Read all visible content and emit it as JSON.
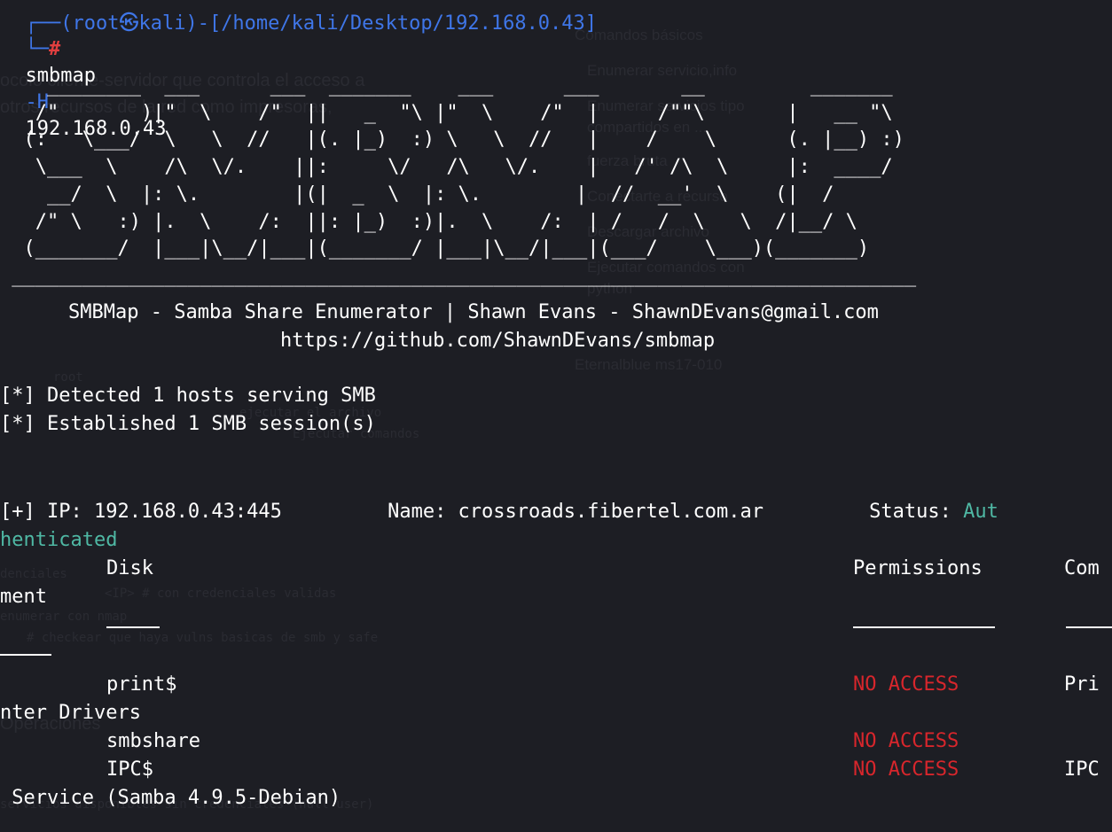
{
  "background_text": {
    "sidebar": [
      "Comandos básicos",
      "Enumerar servicio,info",
      "Enumerar servicios tipo",
      "compartidos en ...",
      "fuerza bruta",
      "Conectarte a recurso",
      "Descargar archivo",
      "Ejecutar comandos con",
      "python",
      "Eternalblue ms17-010"
    ],
    "left_text": [
      "ocolo cliente-servidor que controla el acceso a",
      "otros recursos de la red como impresoras,"
    ],
    "code_lines": [
      "denciales",
      "<IP> # con credenciales validas",
      "enumerar con nmap",
      "# checkear que haya vulns basicas de smb y safe"
    ],
    "bottom_lines": [
      "Operaciones",
      "servicios disponibles sin credenciales (null user)"
    ],
    "upper_code": [
      "root",
      "ejecutar el archivo",
      "Ejecutar comandos"
    ]
  },
  "terminal": {
    "prompt_path": "(root㉿kali)-[/home/kali/Desktop/192.168.0.43]",
    "prompt_hash": "#",
    "command": "smbmap",
    "command_flag": "-H",
    "command_arg": "192.168.0.43",
    "banner_lines": [
      "    ________  ___      ___  _______    ___      ___       __         _______",
      "   /\"       )|\"  \\    /\"  ||   _  \"\\ |\"  \\    /\"  |     /\"\"\\       |   __ \"\\",
      "  (:   \\___/  \\   \\  //   |(. |_)  :) \\   \\  //   |    /    \\      (. |__) :)",
      "   \\___  \\    /\\  \\/.    ||:     \\/   /\\   \\/.    |   /' /\\  \\     |:  ____/",
      "    __/  \\  |: \\.        |(|  _  \\  |: \\.        |  //  __'  \\    (|  /",
      "   /\" \\   :) |.  \\    /:  ||: |_)  :)|.  \\    /:  | /   /  \\   \\  /|__/ \\",
      "  (_______/  |___|\\__/|___|(_______/ |___|\\__/|___|(___/    \\___)(_______)",
      " _____________________________________________________________________________"
    ],
    "credit_line": "SMBMap - Samba Share Enumerator | Shawn Evans - ShawnDEvans@gmail.com",
    "url_line": "https://github.com/ShawnDEvans/smbmap",
    "detected": "[*] Detected 1 hosts serving SMB",
    "established": "[*] Established 1 SMB session(s)",
    "ip_line": "[+] IP: 192.168.0.43:445         Name: crossroads.fibertel.com.ar         Status: ",
    "status_value_part1": "Aut",
    "status_value_part2": "henticated",
    "header_disk": "Disk",
    "header_permissions": "Permissions",
    "header_comment_part1": "Com",
    "header_comment_part2": "ment",
    "shares": [
      {
        "name": "print$",
        "permission": "NO ACCESS",
        "comment_part1": "Pri",
        "comment_part2": "nter Drivers"
      },
      {
        "name": "smbshare",
        "permission": "NO ACCESS",
        "comment_part1": "",
        "comment_part2": ""
      },
      {
        "name": "IPC$",
        "permission": "NO ACCESS",
        "comment_part1": "IPC",
        "comment_part2": " Service (Samba 4.9.5-Debian)"
      }
    ]
  }
}
